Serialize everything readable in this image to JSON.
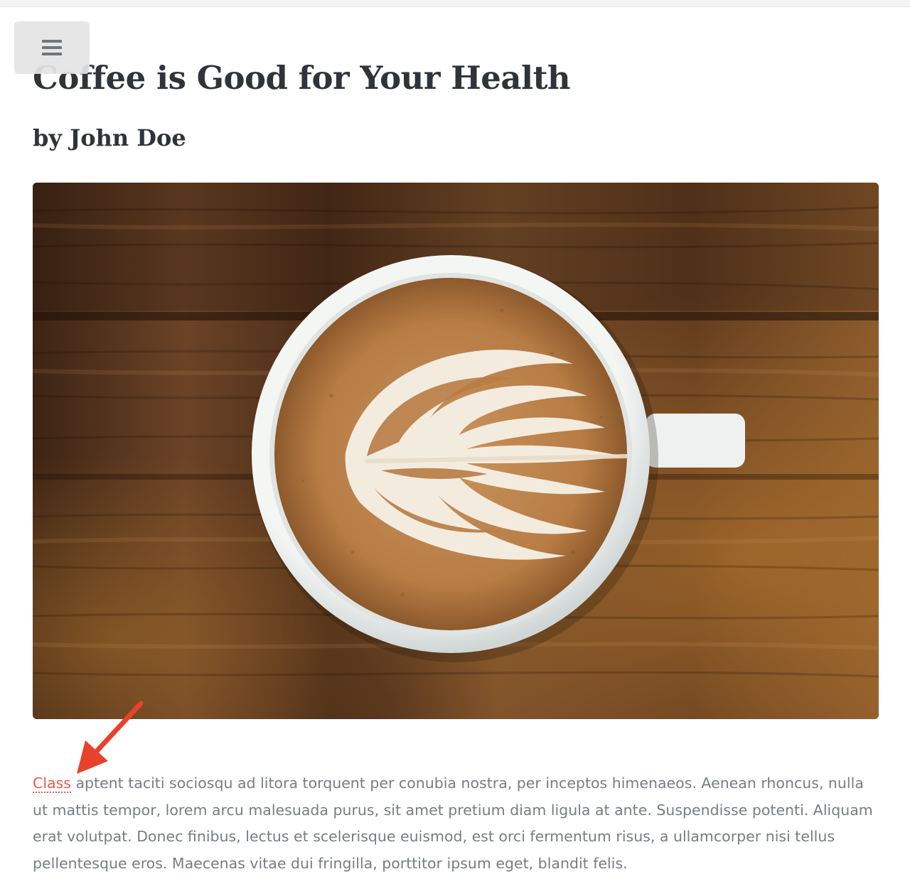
{
  "menu": {
    "icon": "hamburger-menu-icon"
  },
  "article": {
    "title": "Coffee is Good for Your Health",
    "byline": "by John Doe",
    "hero_image": {
      "subject": "latte-art-coffee-cup-on-wooden-table"
    },
    "paragraph": {
      "link_text": "Class",
      "text": " aptent taciti sociosqu ad litora torquent per conubia nostra, per inceptos himenaeos. Aenean rhoncus, nulla ut mattis tempor, lorem arcu malesuada purus, sit amet pretium diam ligula at ante. Suspendisse potenti. Aliquam erat volutpat. Donec finibus, lectus et scelerisque euismod, est orci fermentum risus, a ullamcorper nisi tellus pellentesque eros. Maecenas vitae dui fringilla, porttitor ipsum eget, blandit felis."
    }
  },
  "annotation": {
    "icon": "red-arrow-icon",
    "color": "#e8412c"
  },
  "colors": {
    "link": "#e55a4d",
    "heading": "#30343a",
    "body_text": "#777d84"
  }
}
